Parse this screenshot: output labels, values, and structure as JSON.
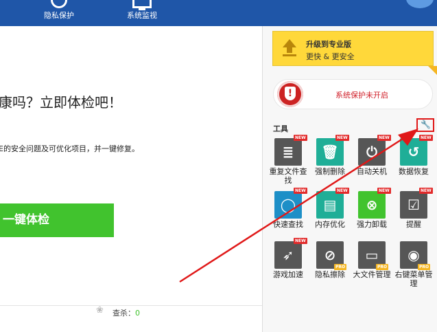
{
  "topbar": {
    "nav": [
      {
        "label": "隐私保护",
        "icon": "shield-icon"
      },
      {
        "label": "系统监视",
        "icon": "monitor-icon"
      }
    ]
  },
  "main": {
    "headline": "康吗？立即体检吧！",
    "description": "E的安全问题及可优化项目，并一键修复。",
    "checkup_button": "一键体检",
    "footer_stat_label": "查杀：",
    "footer_stat_value": "0"
  },
  "upgrade": {
    "title": "升级到专业版",
    "subtitle": "更快 & 更安全"
  },
  "protection": {
    "status_text": "系统保护未开启",
    "icon_glyph": "!"
  },
  "tools": {
    "header": "工具",
    "settings_glyph": "🔧",
    "items": [
      {
        "label": "重复文件查找",
        "color": "#565656",
        "glyph": "≣",
        "badge": "NEW",
        "icon": "duplicate-file-icon"
      },
      {
        "label": "强制删除",
        "color": "#1fae97",
        "glyph": "🗑",
        "badge": "NEW",
        "icon": "trash-icon"
      },
      {
        "label": "自动关机",
        "color": "#565656",
        "glyph": "⏻",
        "badge": "NEW",
        "icon": "power-icon"
      },
      {
        "label": "数据恢复",
        "color": "#1fae97",
        "glyph": "↺",
        "badge": "NEW",
        "icon": "data-recovery-icon"
      },
      {
        "label": "快速查找",
        "color": "#1d8fc7",
        "glyph": "◯",
        "badge": "NEW",
        "icon": "quick-search-icon"
      },
      {
        "label": "内存优化",
        "color": "#1fae97",
        "glyph": "▤",
        "badge": "NEW",
        "icon": "memory-icon"
      },
      {
        "label": "强力卸载",
        "color": "#41c32e",
        "glyph": "⊗",
        "badge": "NEW",
        "icon": "uninstall-icon"
      },
      {
        "label": "提醒",
        "color": "#565656",
        "glyph": "☑",
        "badge": "NEW",
        "icon": "reminder-icon"
      },
      {
        "label": "游戏加速",
        "color": "#565656",
        "glyph": "➶",
        "badge": "NEW",
        "icon": "rocket-icon"
      },
      {
        "label": "隐私擦除",
        "color": "#565656",
        "glyph": "⊘",
        "badge": "PRO",
        "icon": "privacy-eraser-icon"
      },
      {
        "label": "大文件管理",
        "color": "#565656",
        "glyph": "▭",
        "badge": "PRO",
        "icon": "large-file-icon"
      },
      {
        "label": "右键菜单管理",
        "color": "#565656",
        "glyph": "◉",
        "badge": "PRO",
        "icon": "mouse-icon"
      }
    ]
  },
  "annotation": {
    "arrow_color": "#e01818"
  }
}
